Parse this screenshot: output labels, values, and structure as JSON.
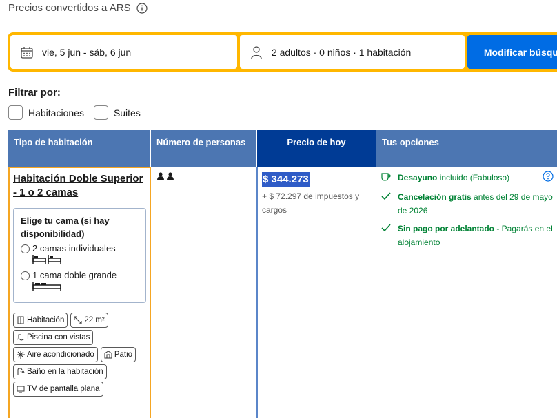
{
  "top_note": {
    "text": "Precios convertidos a ARS",
    "icon": "info-icon"
  },
  "search": {
    "date": "vie, 5 jun - sáb, 6 jun",
    "guests": "2 adultos · 0 niños · 1 habitación",
    "button": "Modificar búsqueda"
  },
  "filters": {
    "title": "Filtrar por:",
    "options": [
      {
        "label": "Habitaciones",
        "checked": false
      },
      {
        "label": "Suites",
        "checked": false
      }
    ]
  },
  "table": {
    "headers": [
      "Tipo de habitación",
      "Número de personas",
      "Precio de hoy",
      "Tus opciones"
    ],
    "room": {
      "name": "Habitación Doble Superior - 1 o 2 camas",
      "bed_choice_title": "Elige tu cama (si hay disponibilidad)",
      "bed_options": [
        "2 camas individuales",
        "1 cama doble grande"
      ],
      "amenities": [
        "Habitación",
        "22 m²",
        "Piscina con vistas",
        "Aire acondicionado",
        "Patio",
        "Baño en la habitación",
        "TV de pantalla plana"
      ]
    },
    "price": {
      "amount": "$ 344.273",
      "taxes": "+ $ 72.297 de impuestos y cargos"
    },
    "options": [
      {
        "bold": "Desayuno",
        "rest": " incluido (Fabuloso)",
        "icon": "coffee-icon"
      },
      {
        "bold": "Cancelación gratis",
        "rest": " antes del 29 de mayo de 2026",
        "icon": "check-icon"
      },
      {
        "bold": "Sin pago por adelantado",
        "rest": " - Pagarás en el alojamiento",
        "icon": "check-icon"
      }
    ]
  },
  "colors": {
    "accent": "#ffb700",
    "primary": "#006ce4",
    "header": "#4c76b2",
    "header_active": "#003b95",
    "green": "#008234"
  }
}
